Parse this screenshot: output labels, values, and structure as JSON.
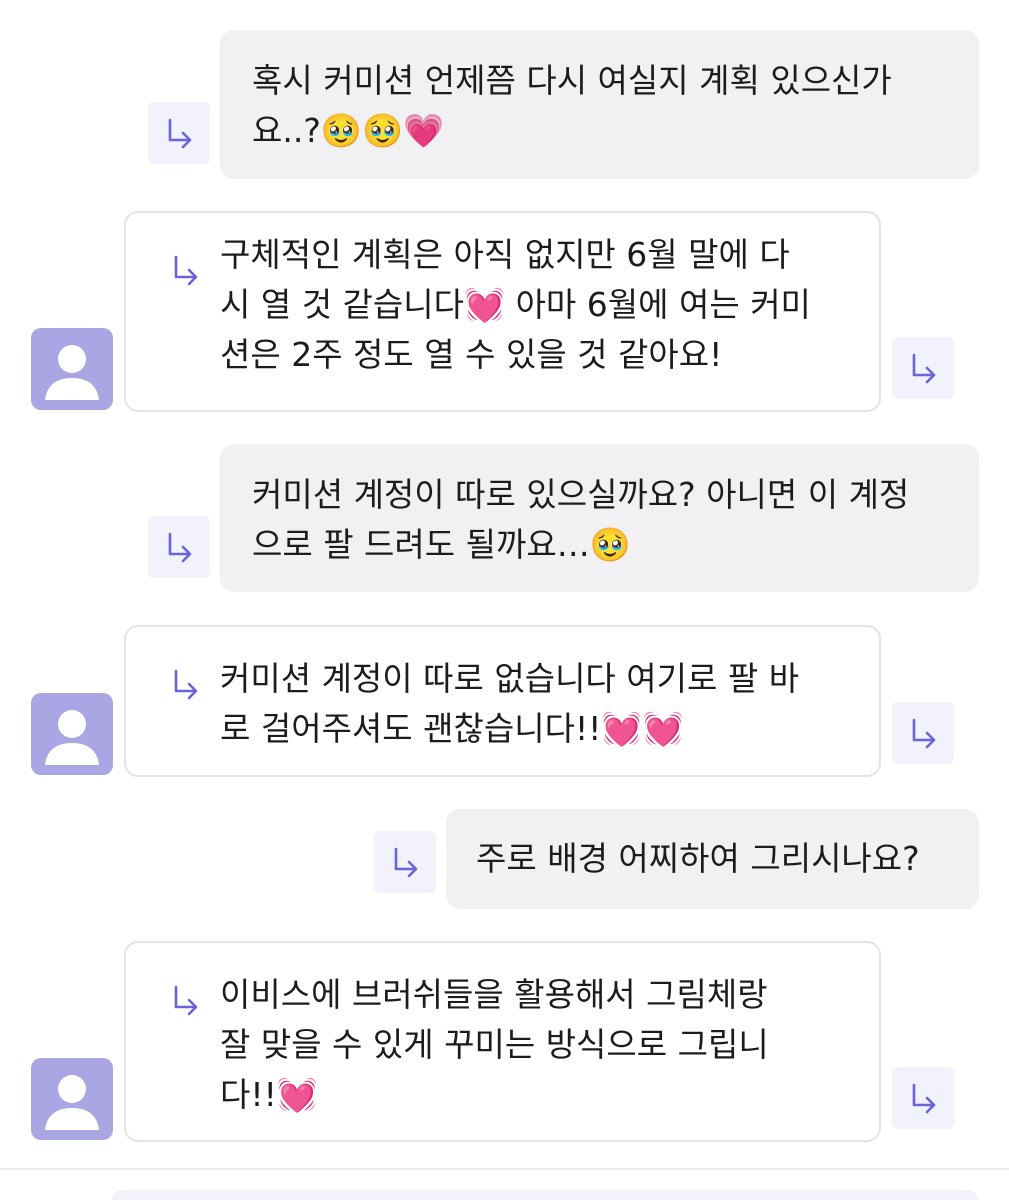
{
  "messages": [
    {
      "role": "sent",
      "text": "혹시 커미션 언제쯤 다시 여실지 계획 있으신가\n요..?🥹🥹💗"
    },
    {
      "role": "received",
      "text": "구체적인 계획은 아직 없지만 6월 말에 다\n시 열 것 같습니다💓 아마 6월에 여는 커미\n션은 2주 정도 열 수 있을 것 같아요!"
    },
    {
      "role": "sent",
      "text": "커미션 계정이 따로 있으실까요? 아니면 이 계정\n으로 팔 드려도 될까요…🥹"
    },
    {
      "role": "received",
      "text": "커미션 계정이 따로 없습니다 여기로 팔 바\n로 걸어주셔도 괜찮습니다!!💓💓"
    },
    {
      "role": "sent",
      "text": "주로 배경 어찌하여 그리시나요?"
    },
    {
      "role": "received",
      "text": "이비스에 브러쉬들을 활용해서 그림체랑\n잘 맞을 수 있게 꾸미는 방식으로 그립니\n다!!💓"
    }
  ],
  "icons": {
    "reply": "reply-arrow-icon",
    "avatar": "default-user-avatar-icon"
  },
  "colors": {
    "sent_bubble": "#f1f1f3",
    "received_border": "#e3e3e8",
    "reply_button_bg": "#f1f2fb",
    "reply_arrow": "#6b63d9",
    "avatar_bg": "#a9a6e3"
  }
}
